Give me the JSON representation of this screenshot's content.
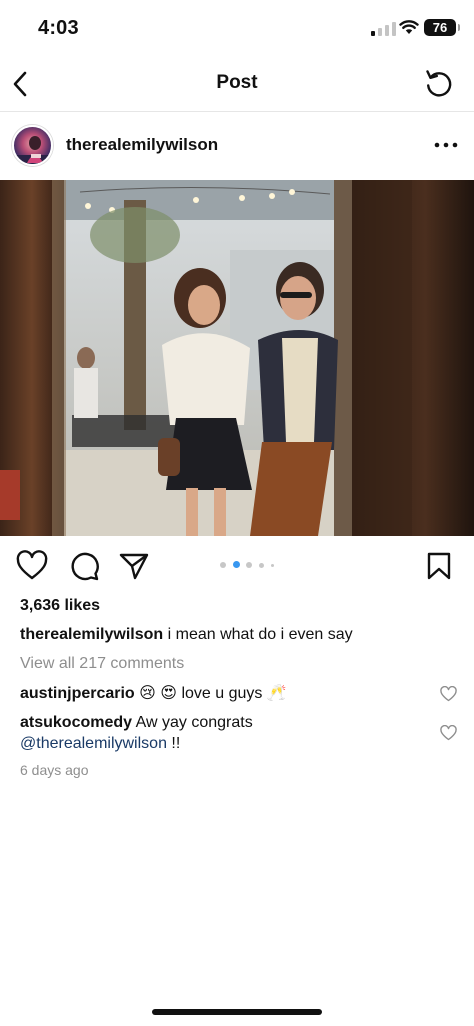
{
  "status_bar": {
    "time": "4:03",
    "battery": "76"
  },
  "nav": {
    "title": "Post"
  },
  "post": {
    "username": "therealemilywilson",
    "likes": "3,636 likes",
    "caption_user": "therealemilywilson",
    "caption_text": "i mean what do i even say",
    "view_all": "View all 217 comments",
    "time_ago": "6 days ago",
    "carousel": {
      "count": 5,
      "active_index": 1
    },
    "icons": [
      "heart-icon",
      "comment-icon",
      "share-icon",
      "bookmark-icon"
    ]
  },
  "comments": [
    {
      "user": "austinjpercario",
      "emoji_1": "😢",
      "emoji_2": "😍",
      "text": "love u guys",
      "emoji_3": "🥂"
    },
    {
      "user": "atsukocomedy",
      "text": "Aw yay congrats",
      "mention": "@therealemilywilson",
      "suffix": "!!"
    }
  ],
  "colors": {
    "accent_dot": "#3897f0",
    "mention": "#1a3a66",
    "muted": "#8e8e8e"
  }
}
